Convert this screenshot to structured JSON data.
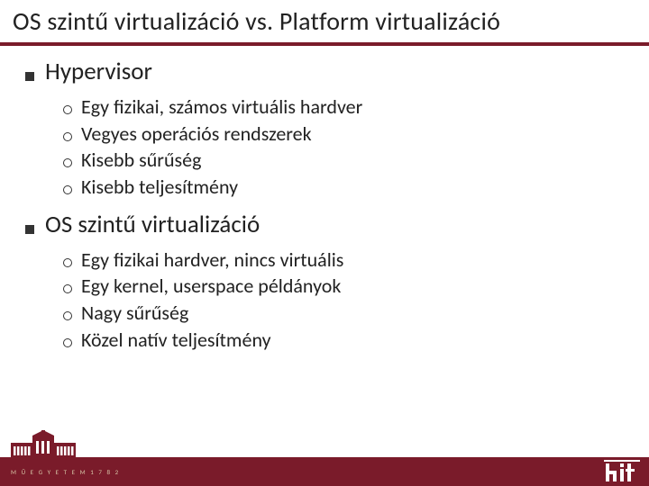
{
  "title": "OS szintű virtualizáció vs. Platform virtualizáció",
  "sections": [
    {
      "heading": "Hypervisor",
      "items": [
        "Egy fizikai, számos virtuális hardver",
        "Vegyes operációs rendszerek",
        "Kisebb sűrűség",
        "Kisebb teljesítmény"
      ]
    },
    {
      "heading": "OS szintű virtualizáció",
      "items": [
        "Egy fizikai hardver, nincs virtuális",
        "Egy kernel, userspace példányok",
        "Nagy sűrűség",
        "Közel natív teljesítmény"
      ]
    }
  ],
  "footer": {
    "left_text": "M Ű E G Y E T E M   1 7 8 2",
    "logo_text": "hit"
  },
  "colors": {
    "accent": "#7a1b2a"
  }
}
